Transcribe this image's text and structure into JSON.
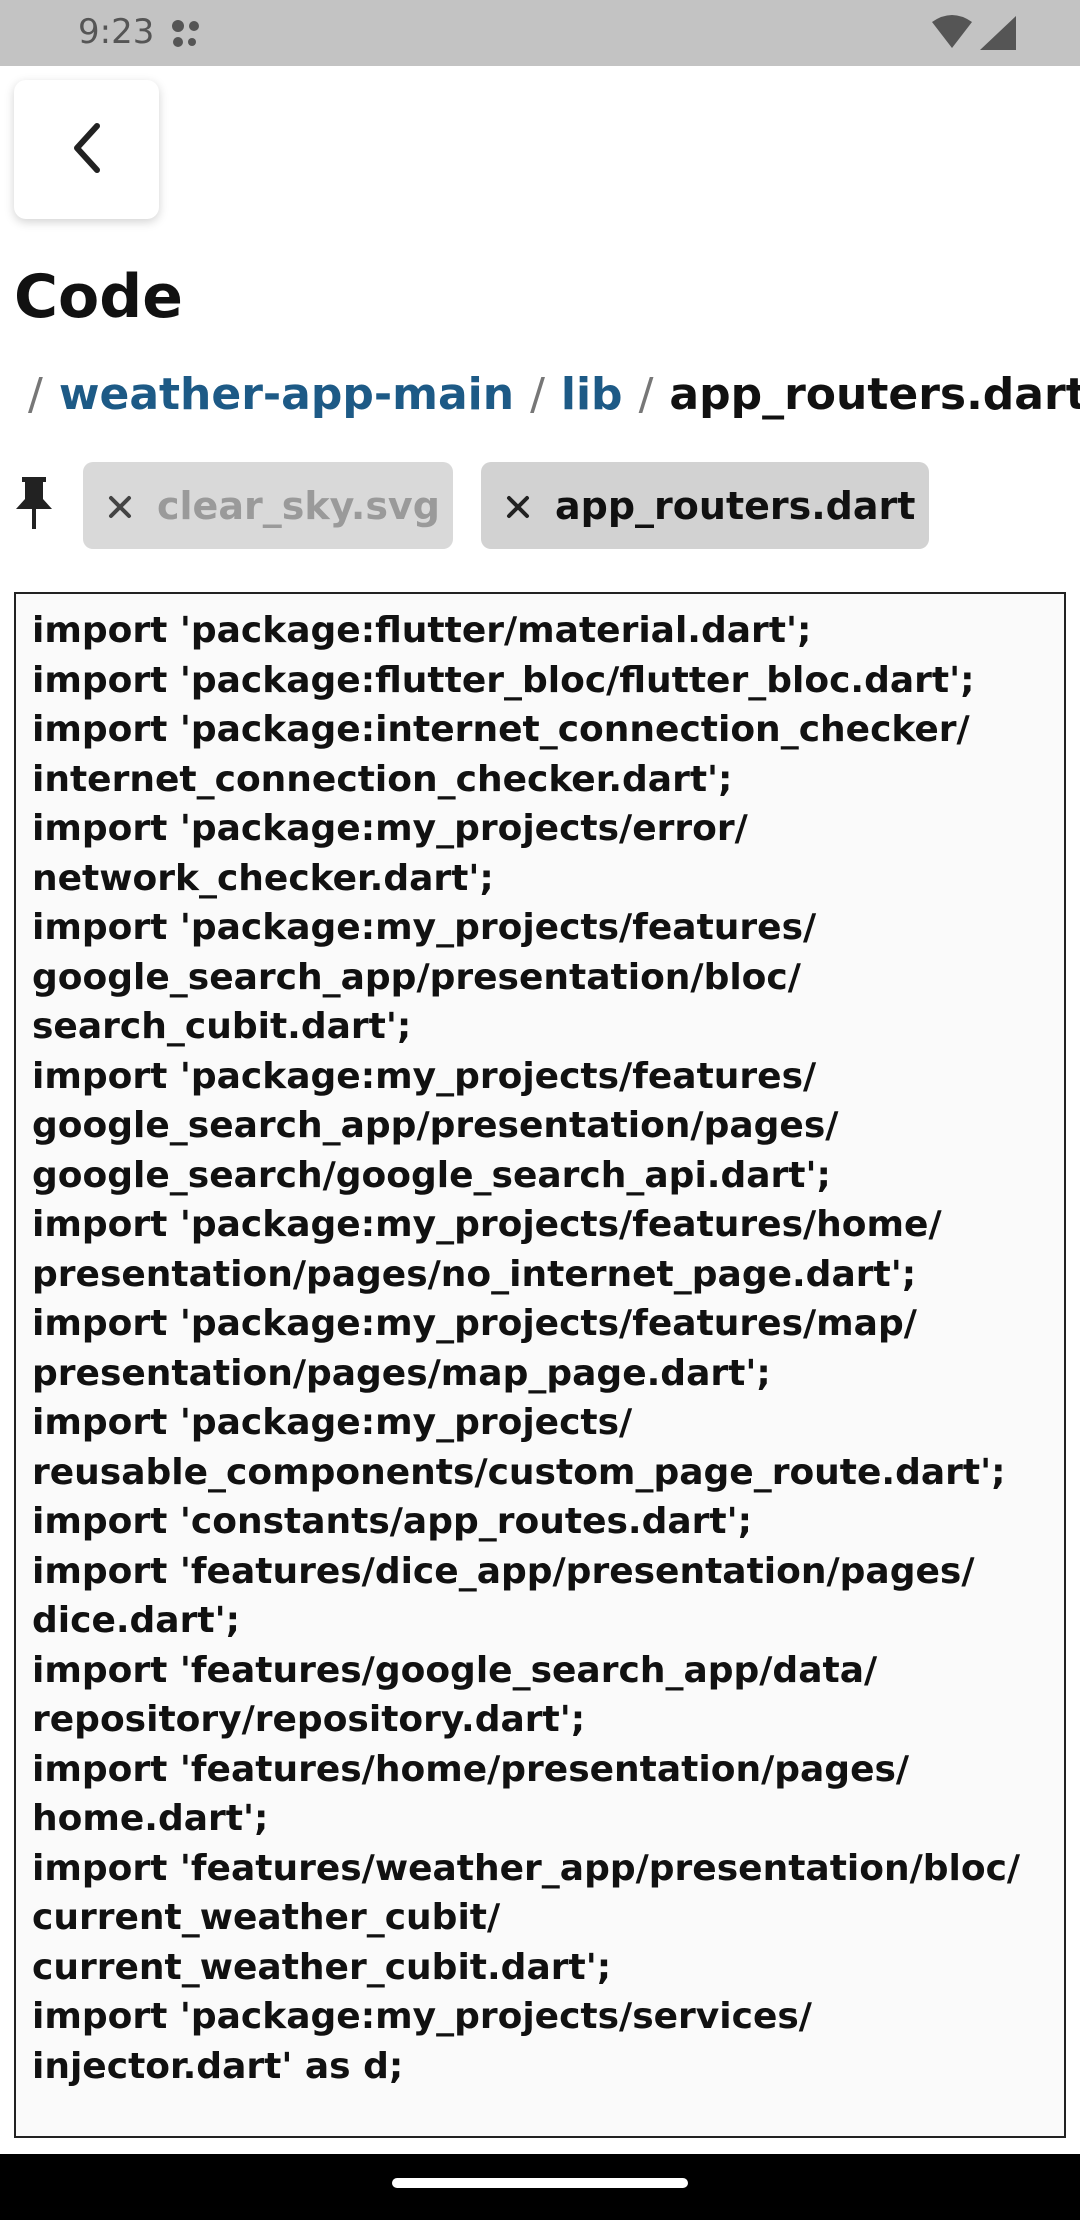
{
  "status_bar": {
    "time": "9:23"
  },
  "header": {
    "title": "Code"
  },
  "breadcrumb": {
    "separator": "/",
    "items": [
      "weather-app-main",
      "lib"
    ],
    "current": "app_routers.dart"
  },
  "tabs": [
    {
      "label": "clear_sky.svg",
      "active": false
    },
    {
      "label": "app_routers.dart",
      "active": true
    }
  ],
  "code": {
    "content": "import 'package:flutter/material.dart';\nimport 'package:flutter_bloc/flutter_bloc.dart';\nimport 'package:internet_connection_checker/\ninternet_connection_checker.dart';\nimport 'package:my_projects/error/\nnetwork_checker.dart';\nimport 'package:my_projects/features/\ngoogle_search_app/presentation/bloc/\nsearch_cubit.dart';\nimport 'package:my_projects/features/\ngoogle_search_app/presentation/pages/\ngoogle_search/google_search_api.dart';\nimport 'package:my_projects/features/home/\npresentation/pages/no_internet_page.dart';\nimport 'package:my_projects/features/map/\npresentation/pages/map_page.dart';\nimport 'package:my_projects/\nreusable_components/custom_page_route.dart';\nimport 'constants/app_routes.dart';\nimport 'features/dice_app/presentation/pages/\ndice.dart';\nimport 'features/google_search_app/data/\nrepository/repository.dart';\nimport 'features/home/presentation/pages/\nhome.dart';\nimport 'features/weather_app/presentation/bloc/\ncurrent_weather_cubit/\ncurrent_weather_cubit.dart';\nimport 'package:my_projects/services/\ninjector.dart' as d;"
  },
  "colors": {
    "status_bar_bg": "#c3c3c3",
    "link": "#1d5a86",
    "tab_inactive_bg": "#d9d9d9",
    "tab_active_bg": "#d2d2d2",
    "code_bg": "#fafafa",
    "nav_bar_bg": "#000000"
  },
  "icons": {
    "back": "chevron-left-icon",
    "pin": "pin-icon",
    "tab_close": "close-icon",
    "wifi": "wifi-icon",
    "signal": "signal-icon"
  }
}
